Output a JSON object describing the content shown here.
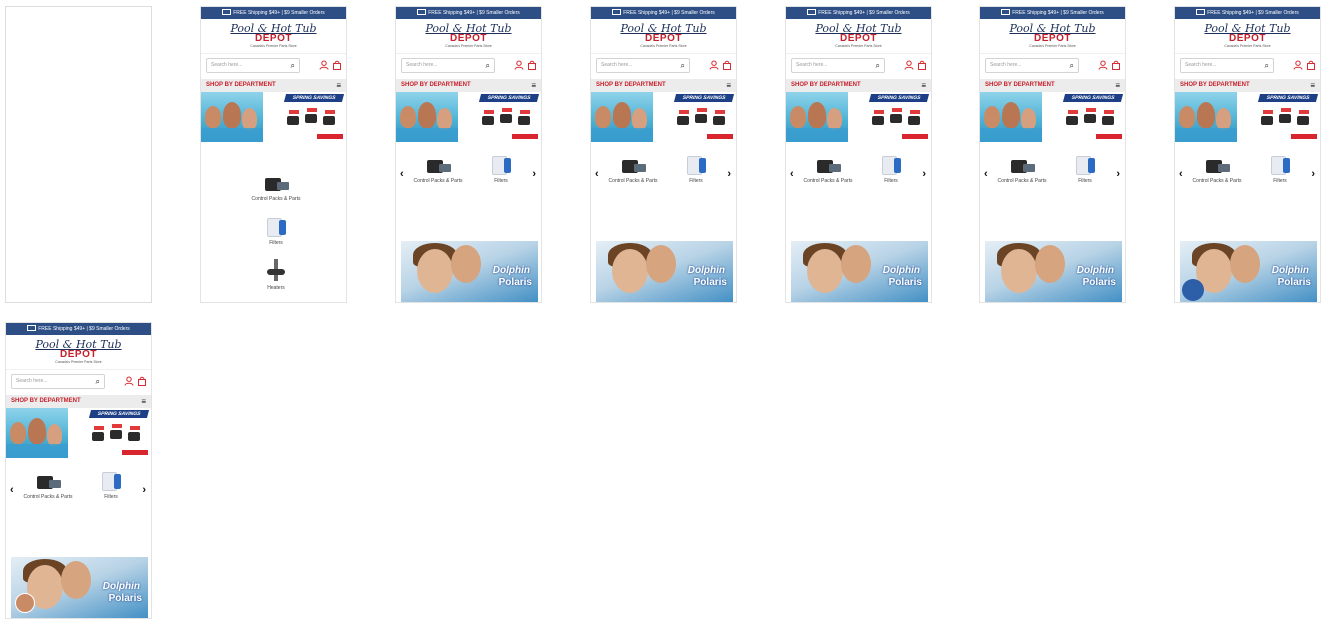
{
  "header": {
    "shipping_text": "FREE Shipping $49+ | $9 Smaller Orders",
    "logo_line1": "Pool & Hot Tub",
    "logo_line2": "DEPOT",
    "logo_tagline": "Canada's Premier Parts Store",
    "search_placeholder": "Search here...",
    "search_icon": "search-icon",
    "account_icon": "account-icon",
    "cart_icon": "cart-icon"
  },
  "nav": {
    "shop_by_department": "SHOP BY DEPARTMENT",
    "menu_icon": "hamburger-icon"
  },
  "banner": {
    "headline": "SPRING SAVINGS"
  },
  "categories": [
    {
      "label": "Control Packs & Parts",
      "icon": "control-pack-icon"
    },
    {
      "label": "Filters",
      "icon": "filter-icon"
    },
    {
      "label": "Heaters",
      "icon": "heater-icon"
    }
  ],
  "promo": {
    "brand1": "Dolphin",
    "brand2": "Polaris"
  },
  "arrows": {
    "prev": "‹",
    "next": "›"
  }
}
